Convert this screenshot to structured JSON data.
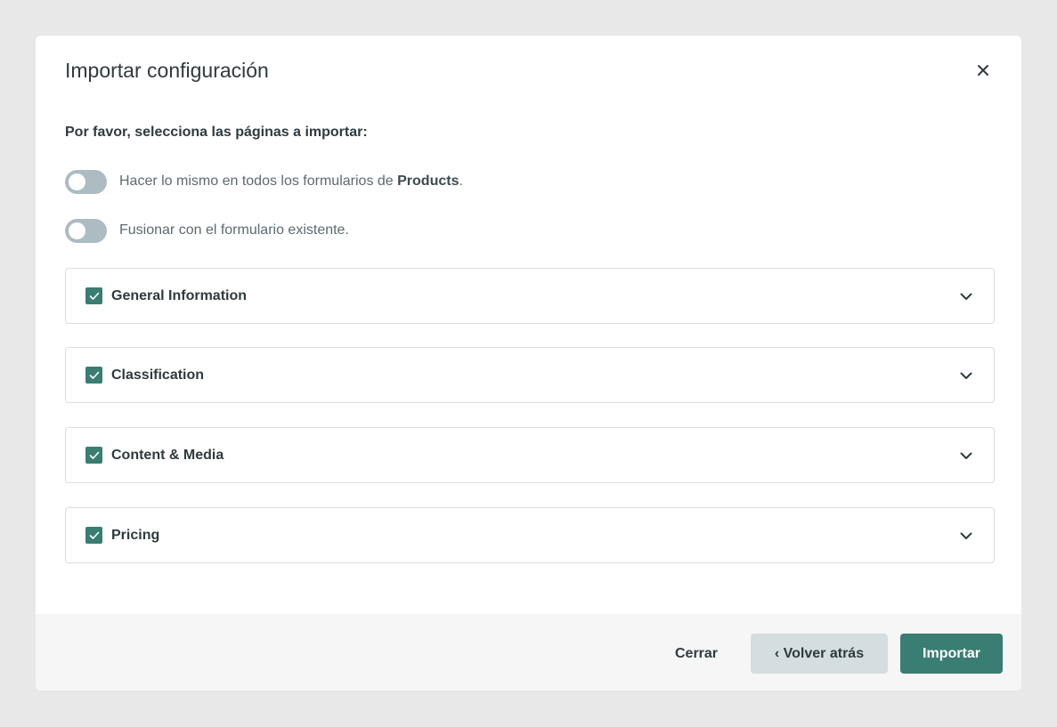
{
  "dialog": {
    "title": "Importar configuración",
    "instruction": "Por favor, selecciona las páginas a importar:"
  },
  "toggles": [
    {
      "label_prefix": "Hacer lo mismo en todos los formularios de ",
      "label_bold": "Products",
      "label_suffix": ".",
      "checked": false
    },
    {
      "label_prefix": "Fusionar con el formulario existente.",
      "label_bold": "",
      "label_suffix": "",
      "checked": false
    }
  ],
  "sections": [
    {
      "label": "General Information",
      "checked": true
    },
    {
      "label": "Classification",
      "checked": true
    },
    {
      "label": "Content & Media",
      "checked": true
    },
    {
      "label": "Pricing",
      "checked": true
    }
  ],
  "footer": {
    "close_label": "Cerrar",
    "back_label": "‹ Volver atrás",
    "import_label": "Importar"
  },
  "colors": {
    "accent": "#3a7d72",
    "toggle_off": "#adbcc2",
    "secondary_button": "#d4dde0"
  },
  "icons": {
    "close": "close-icon",
    "check": "check-icon",
    "expand": "chevron-down-icon"
  }
}
